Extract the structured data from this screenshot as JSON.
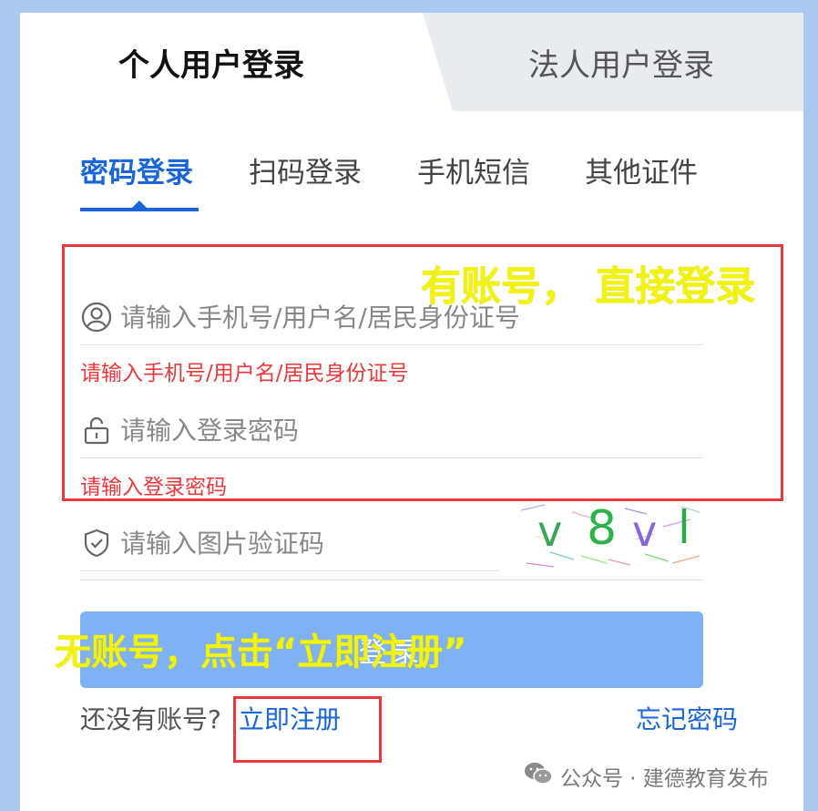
{
  "tabs": {
    "personal": "个人用户登录",
    "legal": "法人用户登录"
  },
  "subtabs": [
    "密码登录",
    "扫码登录",
    "手机短信",
    "其他证件"
  ],
  "form": {
    "account_placeholder": "请输入手机号/用户名/居民身份证号",
    "account_error": "请输入手机号/用户名/居民身份证号",
    "password_placeholder": "请输入登录密码",
    "password_error": "请输入登录密码",
    "captcha_placeholder": "请输入图片验证码",
    "captcha_chars": [
      "v",
      "8",
      "v",
      "l"
    ],
    "login_label": "登录"
  },
  "footer": {
    "no_account": "还没有账号?",
    "register": "立即注册",
    "forgot": "忘记密码"
  },
  "annotations": {
    "has_account": "有账号， 直接登录",
    "no_account": "无账号，点击“立即注册”"
  },
  "watermark": "公众号 · 建德教育发布",
  "colors": {
    "accent": "#1a66d6",
    "error": "#e8393c",
    "button": "#7fb2f4",
    "annotation": "#f2f20f"
  }
}
